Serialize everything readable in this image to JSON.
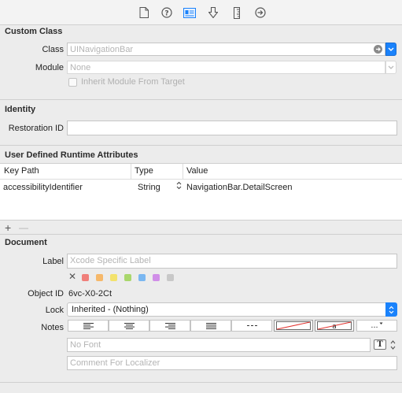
{
  "colors": {
    "accent": "#1a82fb",
    "background": "#ececec",
    "field_bg": "#ffffff"
  },
  "toolbar": {
    "icons": [
      "file-inspector-icon",
      "quick-help-icon",
      "identity-inspector-icon",
      "attributes-inspector-icon",
      "size-inspector-icon",
      "connections-inspector-icon"
    ],
    "selected": "identity-inspector-icon"
  },
  "custom_class": {
    "title": "Custom Class",
    "class_label": "Class",
    "class_value": "UINavigationBar",
    "module_label": "Module",
    "module_value": "None",
    "inherit_label": "Inherit Module From Target"
  },
  "identity": {
    "title": "Identity",
    "restoration_label": "Restoration ID",
    "restoration_value": ""
  },
  "runtime_attributes": {
    "title": "User Defined Runtime Attributes",
    "columns": [
      "Key Path",
      "Type",
      "Value"
    ],
    "rows": [
      {
        "key_path": "accessibilityIdentifier",
        "type": "String",
        "value": "NavigationBar.DetailScreen"
      }
    ],
    "add_label": "+",
    "remove_label": "—"
  },
  "document": {
    "title": "Document",
    "label_label": "Label",
    "label_placeholder": "Xcode Specific Label",
    "swatch_clear": "✕",
    "swatches": [
      "#f07f7a",
      "#f6b86a",
      "#f3e26c",
      "#a9d76c",
      "#7ab7f1",
      "#d08ee8",
      "#c8c8c8"
    ],
    "object_id_label": "Object ID",
    "object_id_value": "6vc-X0-2Ct",
    "lock_label": "Lock",
    "lock_value": "Inherited - (Nothing)",
    "notes_label": "Notes",
    "notes_more": "...",
    "font_placeholder": "No Font",
    "comment_placeholder": "Comment For Localizer"
  }
}
